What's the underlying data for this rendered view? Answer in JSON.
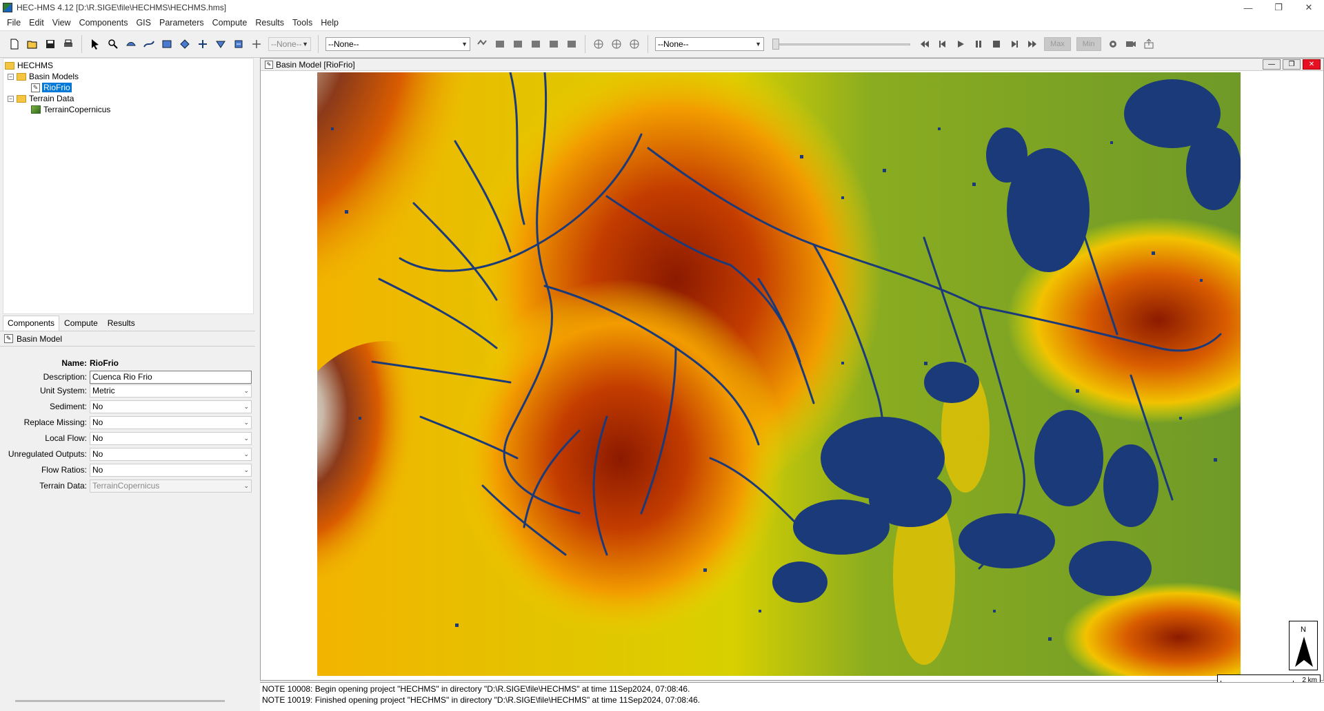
{
  "window": {
    "title": "HEC-HMS 4.12 [D:\\R.SIGE\\file\\HECHMS\\HECHMS.hms]"
  },
  "menu": [
    "File",
    "Edit",
    "View",
    "Components",
    "GIS",
    "Parameters",
    "Compute",
    "Results",
    "Tools",
    "Help"
  ],
  "toolbar": {
    "select1": "--None--",
    "select2": "--None--",
    "select3": "--None--",
    "max_label": "Max",
    "min_label": "Min"
  },
  "tree": {
    "root": "HECHMS",
    "basin_models_folder": "Basin Models",
    "basin_model": "RioFrio",
    "terrain_folder": "Terrain Data",
    "terrain_item": "TerrainCopernicus"
  },
  "tabs": [
    "Components",
    "Compute",
    "Results"
  ],
  "props": {
    "header": "Basin Model",
    "name_label": "Name:",
    "name_value": "RioFrio",
    "description_label": "Description:",
    "description_value": "Cuenca Rio Frio",
    "unit_system_label": "Unit System:",
    "unit_system_value": "Metric",
    "sediment_label": "Sediment:",
    "sediment_value": "No",
    "replace_missing_label": "Replace Missing:",
    "replace_missing_value": "No",
    "local_flow_label": "Local Flow:",
    "local_flow_value": "No",
    "unregulated_label": "Unregulated Outputs:",
    "unregulated_value": "No",
    "flow_ratios_label": "Flow Ratios:",
    "flow_ratios_value": "No",
    "terrain_label": "Terrain Data:",
    "terrain_value": "TerrainCopernicus"
  },
  "basin_window": {
    "title": "Basin Model [RioFrio]",
    "north": "N",
    "scale": "2 km"
  },
  "log": [
    "NOTE 10008:  Begin opening project \"HECHMS\" in directory \"D:\\R.SIGE\\file\\HECHMS\" at time 11Sep2024, 07:08:46.",
    "NOTE 10019:  Finished opening project \"HECHMS\" in directory \"D:\\R.SIGE\\file\\HECHMS\" at time 11Sep2024, 07:08:46."
  ],
  "colors": {
    "selection": "#0078d7",
    "stream": "#1a3a7a",
    "dem_high": "#f0f0f0",
    "dem_mid": "#8b2500",
    "dem_low": "#6b9a2a"
  }
}
